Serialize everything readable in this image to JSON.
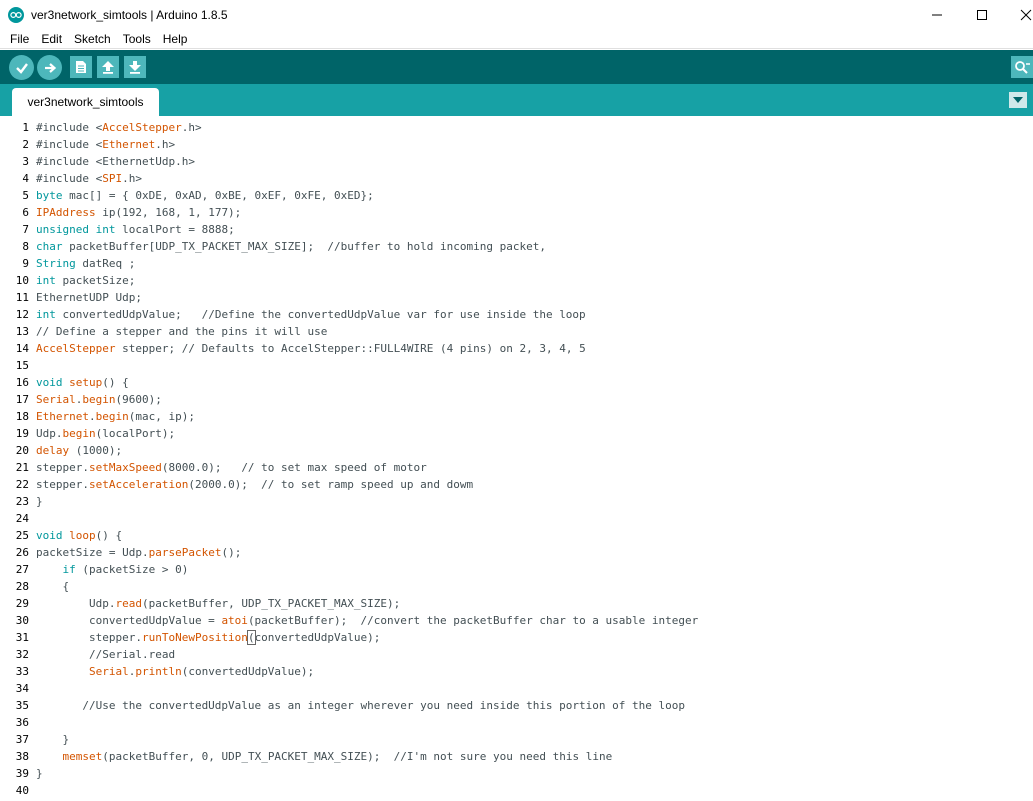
{
  "window": {
    "title": "ver3network_simtools | Arduino 1.8.5",
    "minimize_glyph": "—",
    "maximize_glyph": "☐",
    "close_glyph": "✕"
  },
  "menu": [
    "File",
    "Edit",
    "Sketch",
    "Tools",
    "Help"
  ],
  "toolbar": {
    "buttons": [
      "verify-icon",
      "upload-icon",
      "new-icon",
      "open-icon",
      "save-icon"
    ],
    "right": "serial-monitor-icon"
  },
  "tabs": [
    {
      "label": "ver3network_simtools"
    }
  ],
  "colors": {
    "toolbar_bg": "#006468",
    "tabbar_bg": "#17a1a5",
    "button_bg": "#4db7bb",
    "keyword": "#00979c",
    "function": "#d35400"
  },
  "code_lines": [
    [
      [
        "#include <",
        "p"
      ],
      [
        "AccelStepper",
        "f"
      ],
      [
        ".h>",
        "p"
      ]
    ],
    [
      [
        "#include <",
        "p"
      ],
      [
        "Ethernet",
        "f"
      ],
      [
        ".h>",
        "p"
      ]
    ],
    [
      [
        "#include <EthernetUdp.h>",
        "p"
      ]
    ],
    [
      [
        "#include <",
        "p"
      ],
      [
        "SPI",
        "f"
      ],
      [
        ".h>",
        "p"
      ]
    ],
    [
      [
        "byte",
        "k"
      ],
      [
        " mac[] = { 0xDE, 0xAD, 0xBE, 0xEF, 0xFE, 0xED};",
        "p"
      ]
    ],
    [
      [
        "IPAddress",
        "f"
      ],
      [
        " ip(192, 168, 1, 177);",
        "p"
      ]
    ],
    [
      [
        "unsigned",
        "k"
      ],
      [
        " ",
        "p"
      ],
      [
        "int",
        "k"
      ],
      [
        " localPort = 8888;",
        "p"
      ]
    ],
    [
      [
        "char",
        "k"
      ],
      [
        " packetBuffer[UDP_TX_PACKET_MAX_SIZE];  //buffer to hold incoming packet,",
        "p"
      ]
    ],
    [
      [
        "String",
        "k"
      ],
      [
        " datReq ;",
        "p"
      ]
    ],
    [
      [
        "int",
        "k"
      ],
      [
        " packetSize;",
        "p"
      ]
    ],
    [
      [
        "EthernetUDP Udp;",
        "p"
      ]
    ],
    [
      [
        "int",
        "k"
      ],
      [
        " convertedUdpValue;   //Define the convertedUdpValue var for use inside the loop",
        "p"
      ]
    ],
    [
      [
        "// Define a stepper and the pins it will use",
        "p"
      ]
    ],
    [
      [
        "AccelStepper",
        "f"
      ],
      [
        " stepper; // Defaults to AccelStepper::FULL4WIRE (4 pins) on 2, 3, 4, 5",
        "p"
      ]
    ],
    [],
    [
      [
        "void",
        "k"
      ],
      [
        " ",
        "p"
      ],
      [
        "setup",
        "f"
      ],
      [
        "() {",
        "p"
      ]
    ],
    [
      [
        "Serial",
        "f"
      ],
      [
        ".",
        "p"
      ],
      [
        "begin",
        "f"
      ],
      [
        "(9600);",
        "p"
      ]
    ],
    [
      [
        "Ethernet",
        "f"
      ],
      [
        ".",
        "p"
      ],
      [
        "begin",
        "f"
      ],
      [
        "(mac, ip);",
        "p"
      ]
    ],
    [
      [
        "Udp.",
        "p"
      ],
      [
        "begin",
        "f"
      ],
      [
        "(localPort);",
        "p"
      ]
    ],
    [
      [
        "delay",
        "f"
      ],
      [
        " (1000);",
        "p"
      ]
    ],
    [
      [
        "stepper.",
        "p"
      ],
      [
        "setMaxSpeed",
        "f"
      ],
      [
        "(8000.0);   // to set max speed of motor",
        "p"
      ]
    ],
    [
      [
        "stepper.",
        "p"
      ],
      [
        "setAcceleration",
        "f"
      ],
      [
        "(2000.0);  // to set ramp speed up and dowm",
        "p"
      ]
    ],
    [
      [
        "}",
        "p"
      ]
    ],
    [],
    [
      [
        "void",
        "k"
      ],
      [
        " ",
        "p"
      ],
      [
        "loop",
        "f"
      ],
      [
        "() {",
        "p"
      ]
    ],
    [
      [
        "packetSize = Udp.",
        "p"
      ],
      [
        "parsePacket",
        "f"
      ],
      [
        "();",
        "p"
      ]
    ],
    [
      [
        "    ",
        "p"
      ],
      [
        "if",
        "k"
      ],
      [
        " (packetSize > 0)",
        "p"
      ]
    ],
    [
      [
        "    {",
        "p"
      ]
    ],
    [
      [
        "        Udp.",
        "p"
      ],
      [
        "read",
        "f"
      ],
      [
        "(packetBuffer, UDP_TX_PACKET_MAX_SIZE);",
        "p"
      ]
    ],
    [
      [
        "        convertedUdpValue = ",
        "p"
      ],
      [
        "atoi",
        "f"
      ],
      [
        "(packetBuffer);  //convert the packetBuffer char to a usable integer",
        "p"
      ]
    ],
    [
      [
        "        stepper.",
        "p"
      ],
      [
        "runToNewPosition",
        "f"
      ],
      [
        "(",
        "b"
      ],
      [
        "convertedUdpValue",
        "p"
      ],
      [
        ")",
        "c"
      ],
      [
        ";",
        "p"
      ]
    ],
    [
      [
        "        //Serial.read",
        "p"
      ]
    ],
    [
      [
        "        ",
        "p"
      ],
      [
        "Serial",
        "f"
      ],
      [
        ".",
        "p"
      ],
      [
        "println",
        "f"
      ],
      [
        "(convertedUdpValue);",
        "p"
      ]
    ],
    [],
    [
      [
        "       //Use the convertedUdpValue as an integer wherever you need inside this portion of the loop",
        "p"
      ]
    ],
    [],
    [
      [
        "    }",
        "p"
      ]
    ],
    [
      [
        "    ",
        "p"
      ],
      [
        "memset",
        "f"
      ],
      [
        "(packetBuffer, 0, UDP_TX_PACKET_MAX_SIZE);  //I'm not sure you need this line",
        "p"
      ]
    ],
    [
      [
        "}",
        "p"
      ]
    ],
    []
  ]
}
